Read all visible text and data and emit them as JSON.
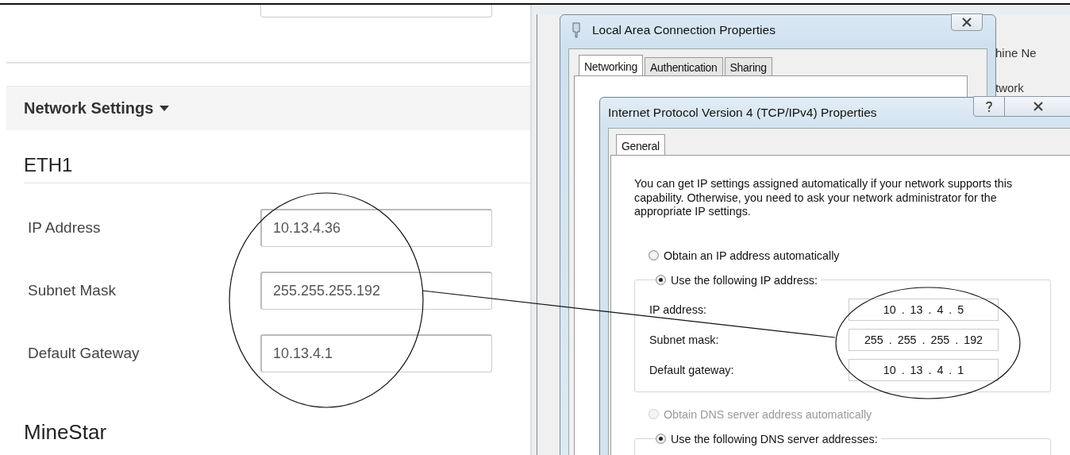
{
  "settings_page": {
    "section_header": {
      "title": "Network Settings"
    },
    "subsections": [
      {
        "title": "ETH1",
        "fields": [
          {
            "label": "IP Address",
            "value": "10.13.4.36"
          },
          {
            "label": "Subnet Mask",
            "value": "255.255.255.192"
          },
          {
            "label": "Default Gateway",
            "value": "10.13.4.1"
          }
        ]
      },
      {
        "title": "MineStar"
      }
    ]
  },
  "background_window": {
    "texts": [
      "hine Ne",
      "twork"
    ]
  },
  "connection_window": {
    "title": "Local Area Connection Properties",
    "tabs": [
      {
        "label": "Networking",
        "selected": true
      },
      {
        "label": "Authentication",
        "selected": false
      },
      {
        "label": "Sharing",
        "selected": false
      }
    ]
  },
  "ipv4_dialog": {
    "title": "Internet Protocol Version 4 (TCP/IPv4) Properties",
    "tabs": [
      {
        "label": "General",
        "selected": true
      }
    ],
    "description": "You can get IP settings assigned automatically if your network supports this capability. Otherwise, you need to ask your network administrator for the appropriate IP settings.",
    "ip_options": [
      {
        "label": "Obtain an IP address automatically",
        "selected": false,
        "disabled": false
      },
      {
        "label": "Use the following IP address:",
        "selected": true,
        "disabled": false
      }
    ],
    "ip_fields": [
      {
        "label": "IP address:",
        "value": "10 . 13 . 4 . 5"
      },
      {
        "label": "Subnet mask:",
        "value": "255 . 255 . 255 . 192"
      },
      {
        "label": "Default gateway:",
        "value": "10 . 13 . 4 . 1"
      }
    ],
    "dns_options": [
      {
        "label": "Obtain DNS server address automatically",
        "selected": false,
        "disabled": true
      },
      {
        "label": "Use the following DNS server addresses:",
        "selected": true,
        "disabled": false
      }
    ]
  }
}
